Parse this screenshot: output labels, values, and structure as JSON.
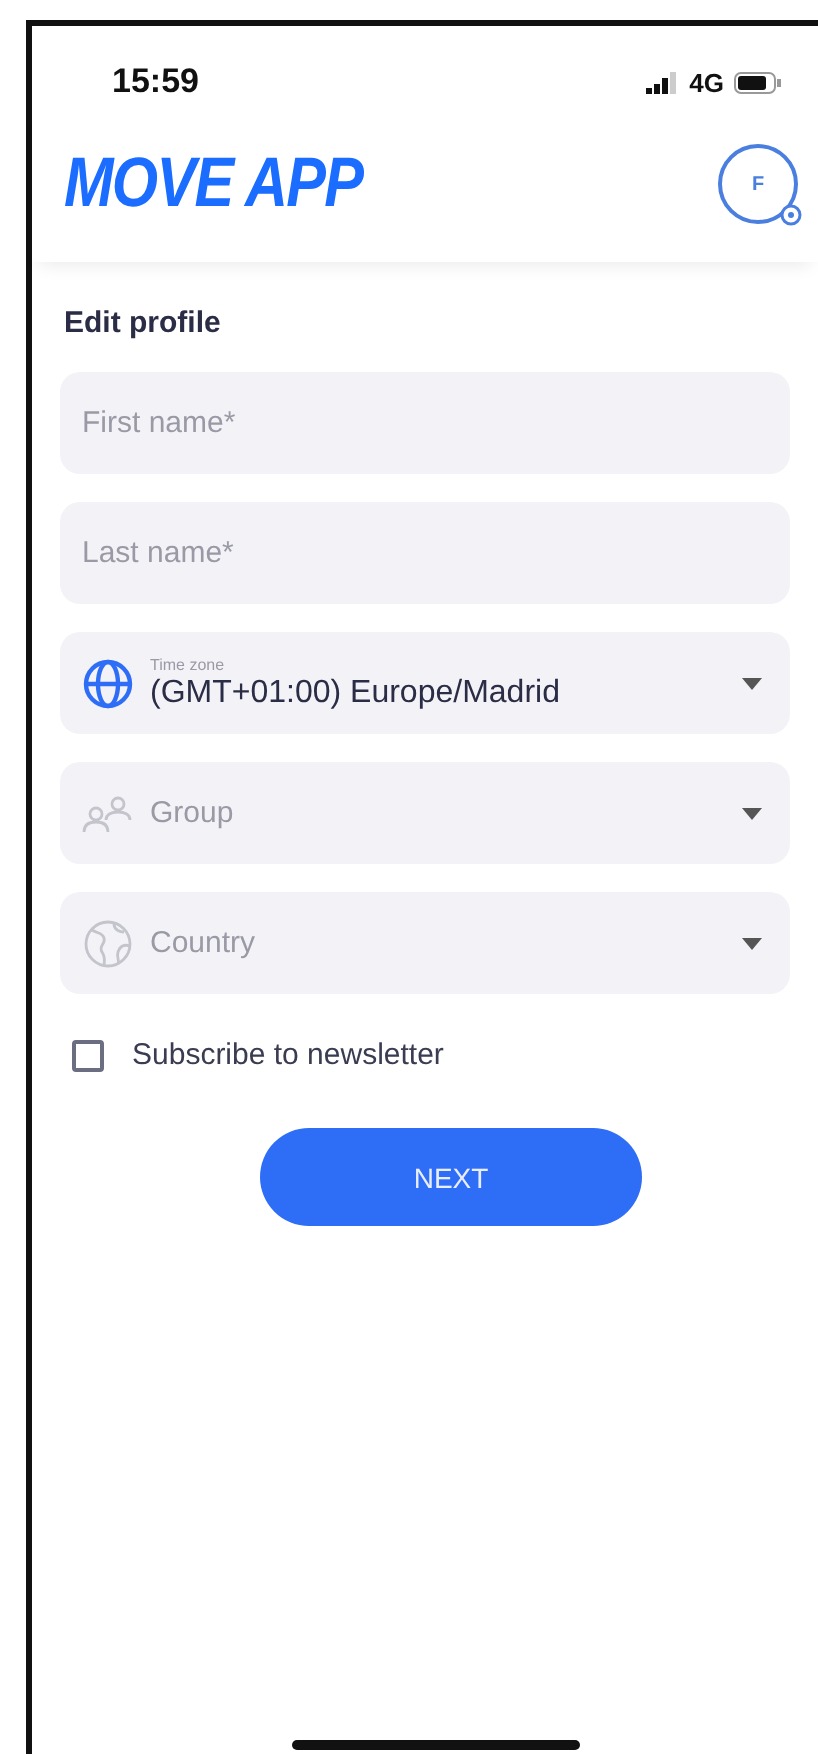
{
  "status_bar": {
    "time": "15:59",
    "network": "4G"
  },
  "header": {
    "title": "MOVE APP",
    "avatar": "F"
  },
  "form": {
    "title": "Edit profile",
    "fields": [
      {
        "kind": "text",
        "placeholder": "First name*"
      },
      {
        "kind": "text",
        "placeholder": "Last name*"
      },
      {
        "kind": "timezone",
        "label": "Time zone",
        "value": "(GMT+01:00) Europe/Madrid"
      },
      {
        "kind": "group",
        "placeholder": "Group"
      },
      {
        "kind": "country",
        "placeholder": "Country"
      }
    ],
    "newsletter": {
      "label": "Subscribe to newsletter",
      "checked": false
    },
    "button": "NEXT"
  }
}
